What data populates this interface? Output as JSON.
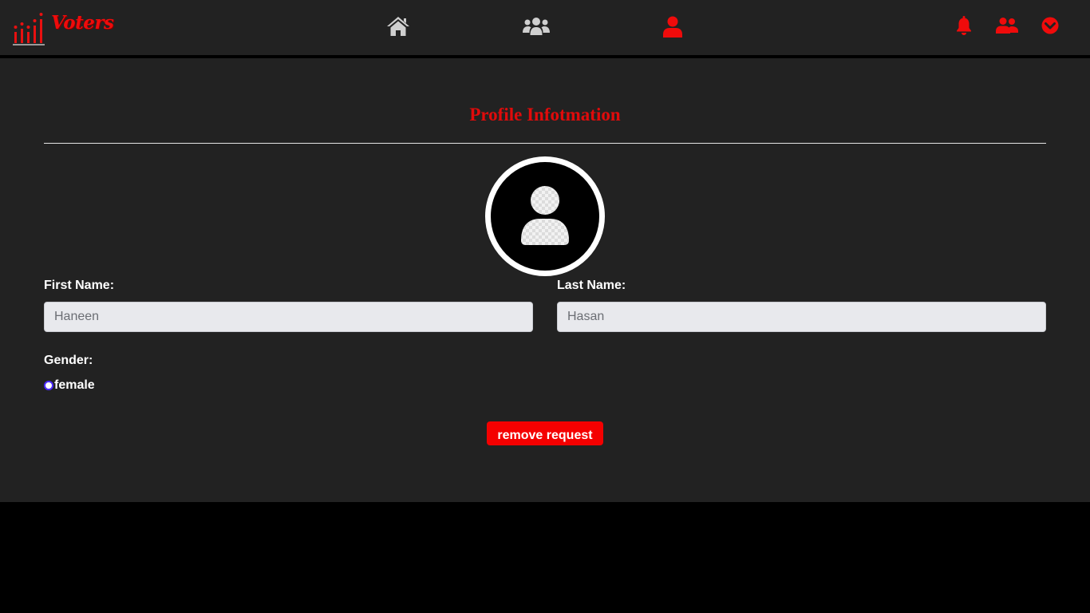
{
  "brand": {
    "name": "Voters",
    "logo_icon": "bar-chart-logo-icon"
  },
  "nav": {
    "center_icons": [
      "home-icon",
      "users-group-icon",
      "user-icon"
    ],
    "active_icon": "user-icon",
    "right_icons": [
      "bell-icon",
      "user-friends-icon",
      "chevron-circle-down-icon"
    ]
  },
  "profile": {
    "title": "Profile Infotmation",
    "avatar_icon": "user-avatar-icon",
    "first_name_label": "First Name:",
    "first_name_placeholder": "Haneen",
    "last_name_label": "Last Name:",
    "last_name_placeholder": "Hasan",
    "gender_label": "Gender:",
    "gender_option": "female",
    "remove_button": "remove request"
  },
  "colors": {
    "accent": "#ef0b0b",
    "inactive_icon": "#cfcfcf",
    "background": "#222222",
    "input_bg": "#e8e9ed",
    "radio": "#4b2bff"
  }
}
